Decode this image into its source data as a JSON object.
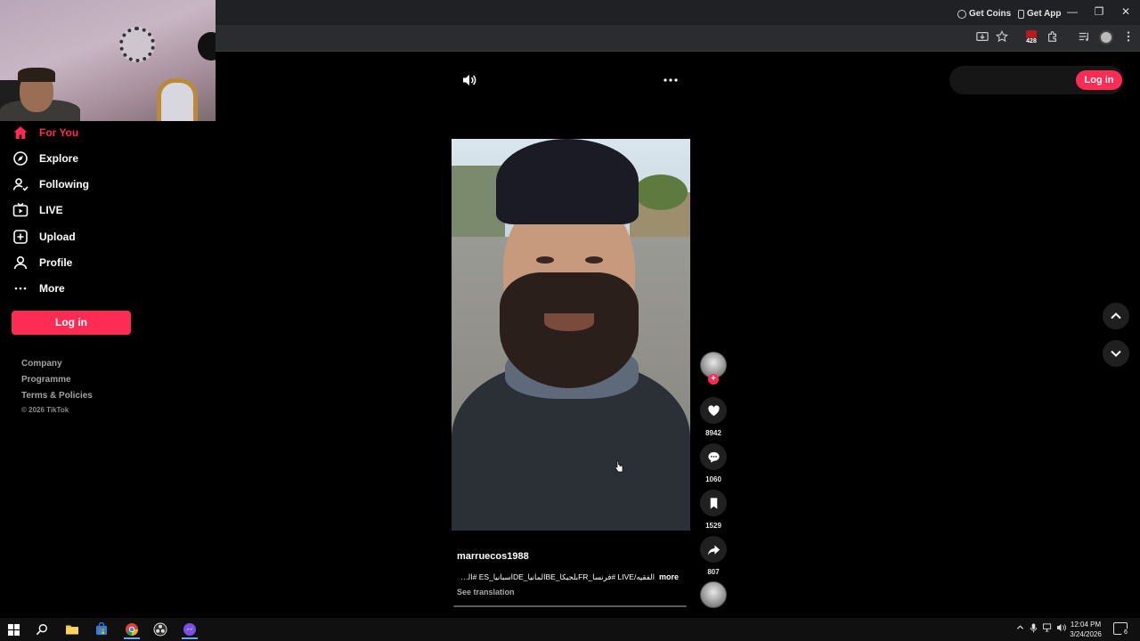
{
  "nav": {
    "items": [
      {
        "label": "For You",
        "icon": "home-icon",
        "active": true
      },
      {
        "label": "Explore",
        "icon": "compass-icon"
      },
      {
        "label": "Following",
        "icon": "following-icon"
      },
      {
        "label": "LIVE",
        "icon": "live-icon"
      },
      {
        "label": "Upload",
        "icon": "upload-icon"
      },
      {
        "label": "Profile",
        "icon": "profile-icon"
      },
      {
        "label": "More",
        "icon": "more-icon"
      }
    ],
    "login_label": "Log in",
    "footer_links": [
      "Company",
      "Programme",
      "Terms & Policies"
    ],
    "copyright": "© 2026 TikTok"
  },
  "header": {
    "get_coins": "Get Coins",
    "get_app": "Get App",
    "login_label": "Log in"
  },
  "video": {
    "username": "marruecos1988",
    "caption": "الفقيه/LIVE #فرنسا_FRبلجيكا_BEالمانيا_DEاسبانيا_ES #المغرب",
    "more_label": "more",
    "see_translation": "See translation"
  },
  "actions": {
    "likes": "8942",
    "comments": "1060",
    "saves": "1529",
    "shares": "807"
  },
  "browser": {
    "extension_badge": "428"
  },
  "taskbar": {
    "time": "12:04 PM",
    "date": "3/24/2026",
    "notifications": "6"
  },
  "colors": {
    "accent": "#fe2c55",
    "background": "#000000"
  }
}
